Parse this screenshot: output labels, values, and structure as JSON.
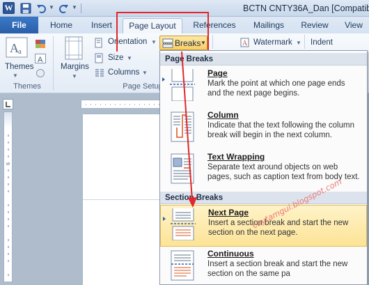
{
  "window": {
    "title": "BCTN CNTY36A_Dan [Compatibili",
    "app_icon_letter": "W"
  },
  "tabs": {
    "file": "File",
    "home": "Home",
    "insert": "Insert",
    "page_layout": "Page Layout",
    "references": "References",
    "mailings": "Mailings",
    "review": "Review",
    "view": "View"
  },
  "ribbon": {
    "themes_button": "Themes",
    "themes_group": "Themes",
    "margins": "Margins",
    "orientation": "Orientation",
    "size": "Size",
    "columns": "Columns",
    "breaks": "Breaks",
    "page_setup_group": "Page Setup",
    "watermark": "Watermark",
    "indent": "Indent"
  },
  "breaks_menu": {
    "page_breaks_header": "Page Breaks",
    "section_breaks_header": "Section Breaks",
    "items": [
      {
        "title": "Page",
        "desc_line1": "Mark the point at which one page ends",
        "desc_line2": "and the next page begins."
      },
      {
        "title": "Column",
        "desc_line1": "Indicate that the text following the column",
        "desc_line2": "break will begin in the next column."
      },
      {
        "title": "Text Wrapping",
        "desc_line1": "Separate text around objects on web",
        "desc_line2": "pages, such as caption text from body text."
      },
      {
        "title": "Next Page",
        "desc_line1": "Insert a section break and start the new",
        "desc_line2": "section on the next page."
      },
      {
        "title": "Continuous",
        "desc_line1": "Insert a section break and start the new",
        "desc_line2": "section on the same pa"
      }
    ]
  },
  "watermark_text": "caytamgui.blogspot.com",
  "colors": {
    "file_tab": "#2a5fa8",
    "highlight_red": "#e2262a",
    "menu_hover": "#fce396"
  }
}
